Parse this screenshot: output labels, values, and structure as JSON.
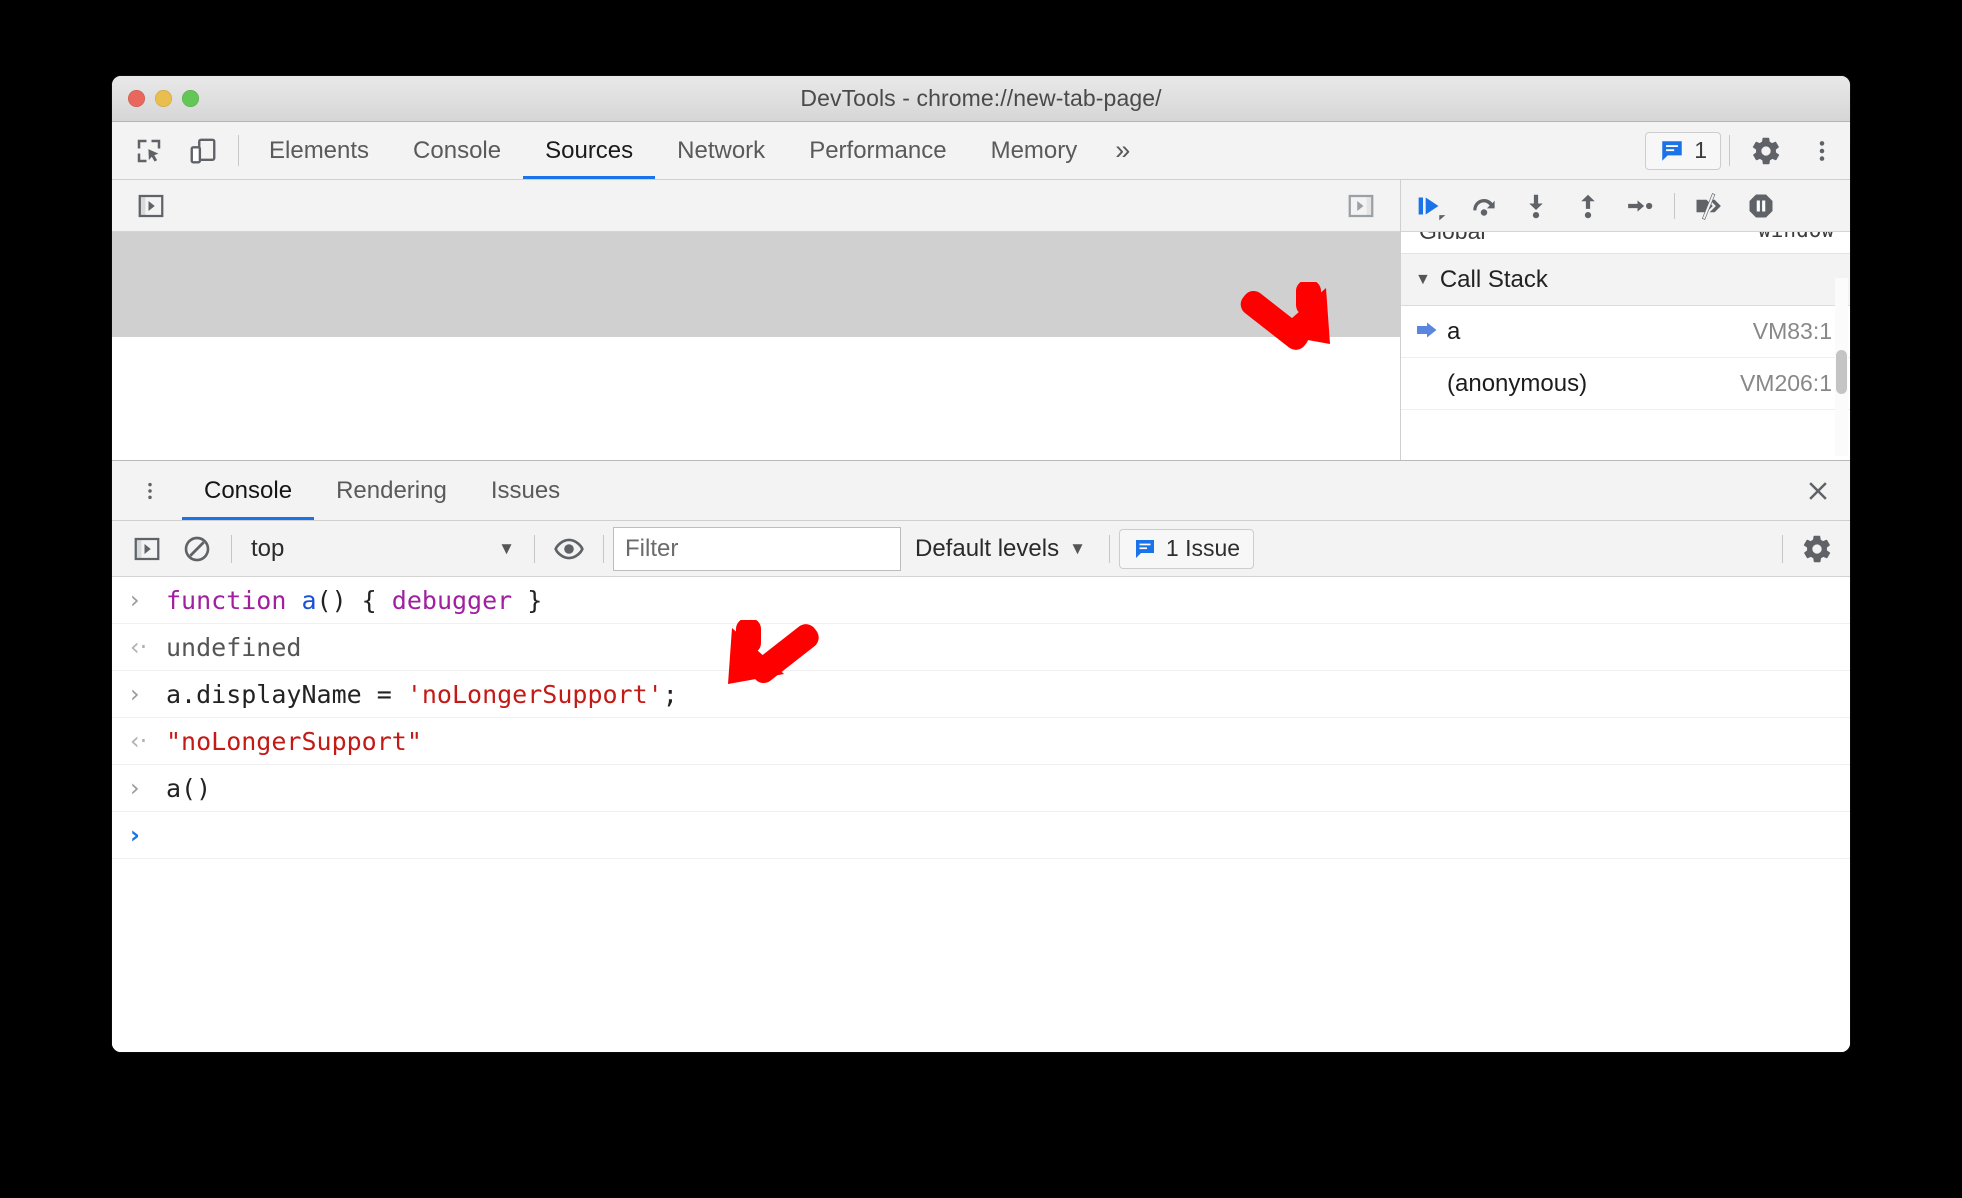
{
  "window": {
    "title": "DevTools - chrome://new-tab-page/"
  },
  "main_tabs": {
    "items": [
      {
        "label": "Elements",
        "active": false
      },
      {
        "label": "Console",
        "active": false
      },
      {
        "label": "Sources",
        "active": true
      },
      {
        "label": "Network",
        "active": false
      },
      {
        "label": "Performance",
        "active": false
      },
      {
        "label": "Memory",
        "active": false
      }
    ],
    "more_label": "»",
    "issues_count": "1",
    "icons": {
      "inspect": "inspect-element-icon",
      "device": "device-toolbar-icon",
      "issues": "issues-speech-bubble-icon",
      "settings": "gear-icon",
      "menu": "kebab-menu-icon"
    }
  },
  "debugger_toolbar": {
    "buttons": [
      {
        "name": "resume-script-execution",
        "icon": "resume-icon"
      },
      {
        "name": "step-over-next-function-call",
        "icon": "step-over-icon"
      },
      {
        "name": "step-into-next-function-call",
        "icon": "step-into-icon"
      },
      {
        "name": "step-out-of-current-function",
        "icon": "step-out-icon"
      },
      {
        "name": "step",
        "icon": "step-icon"
      },
      {
        "name": "deactivate-breakpoints",
        "icon": "deactivate-breakpoints-icon"
      },
      {
        "name": "pause-on-exceptions",
        "icon": "pause-on-exceptions-icon"
      }
    ]
  },
  "debugger_sidebar": {
    "scope_row": {
      "name": "Global",
      "value": "window"
    },
    "call_stack": {
      "header": "Call Stack",
      "expanded_marker": "▼",
      "frames": [
        {
          "name": "a",
          "location": "VM83:1",
          "selected": true
        },
        {
          "name": "(anonymous)",
          "location": "VM206:1",
          "selected": false
        }
      ]
    }
  },
  "drawer": {
    "tabs": [
      {
        "label": "Console",
        "active": true
      },
      {
        "label": "Rendering",
        "active": false
      },
      {
        "label": "Issues",
        "active": false
      }
    ],
    "menu_icon": "kebab-menu-icon",
    "close_icon": "close-icon"
  },
  "console_toolbar": {
    "sidebar_toggle_icon": "console-sidebar-toggle-icon",
    "clear_icon": "clear-console-icon",
    "context": "top",
    "context_caret": "▼",
    "eye_icon": "live-expression-eye-icon",
    "filter_placeholder": "Filter",
    "filter_value": "",
    "levels_label": "Default levels",
    "levels_caret": "▼",
    "issues_label": "1 Issue",
    "settings_icon": "gear-icon"
  },
  "console_output": {
    "lines": [
      {
        "kind": "input",
        "gutter": "›",
        "tokens": [
          {
            "t": "function ",
            "c": "kw"
          },
          {
            "t": "a",
            "c": "fn"
          },
          {
            "t": "() { ",
            "c": "plain"
          },
          {
            "t": "debugger",
            "c": "kw"
          },
          {
            "t": " }",
            "c": "plain"
          }
        ],
        "text": "function a() { debugger }"
      },
      {
        "kind": "output",
        "gutter": "‹·",
        "tokens": [
          {
            "t": "undefined",
            "c": "eval"
          }
        ],
        "text": "undefined"
      },
      {
        "kind": "input",
        "gutter": "›",
        "tokens": [
          {
            "t": "a.displayName = ",
            "c": "plain"
          },
          {
            "t": "'noLongerSupport'",
            "c": "str"
          },
          {
            "t": ";",
            "c": "plain"
          }
        ],
        "text": "a.displayName = 'noLongerSupport';"
      },
      {
        "kind": "output",
        "gutter": "‹·",
        "tokens": [
          {
            "t": "\"noLongerSupport\"",
            "c": "resp-str"
          }
        ],
        "text": "\"noLongerSupport\""
      },
      {
        "kind": "input",
        "gutter": "›",
        "tokens": [
          {
            "t": "a()",
            "c": "plain"
          }
        ],
        "text": "a()"
      },
      {
        "kind": "prompt",
        "gutter": "›",
        "tokens": [],
        "text": ""
      }
    ]
  },
  "annotations": {
    "arrows": [
      {
        "name": "arrow-pointing-to-call-stack-frame",
        "direction": "down-right",
        "color": "#FF0000"
      },
      {
        "name": "arrow-pointing-to-display-name-assignment",
        "direction": "down-left",
        "color": "#FF0000"
      }
    ]
  },
  "colors": {
    "accent": "#1a73e8",
    "annotation": "#FF0000",
    "string": "#c41a16",
    "keyword": "#a020a0"
  }
}
